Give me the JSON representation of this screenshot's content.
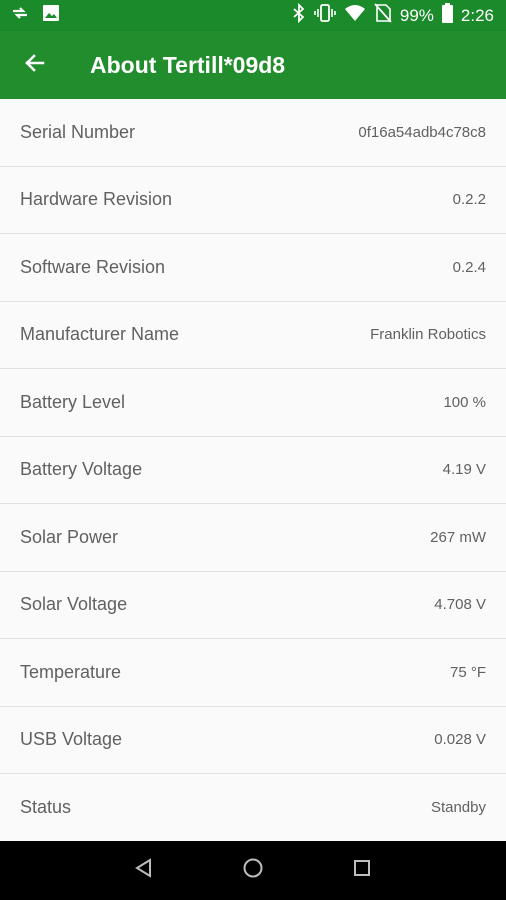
{
  "status_bar": {
    "battery_percent": "99%",
    "time": "2:26",
    "icons": [
      "sync-icon",
      "image-icon",
      "bluetooth-icon",
      "vibrate-icon",
      "wifi-icon",
      "no-sim-icon",
      "battery-icon"
    ]
  },
  "app_bar": {
    "title": "About Tertill*09d8"
  },
  "rows": [
    {
      "label": "Serial Number",
      "value": "0f16a54adb4c78c8"
    },
    {
      "label": "Hardware Revision",
      "value": "0.2.2"
    },
    {
      "label": "Software Revision",
      "value": "0.2.4"
    },
    {
      "label": "Manufacturer Name",
      "value": "Franklin Robotics"
    },
    {
      "label": "Battery Level",
      "value": "100 %"
    },
    {
      "label": "Battery Voltage",
      "value": "4.19 V"
    },
    {
      "label": "Solar Power",
      "value": "267 mW"
    },
    {
      "label": "Solar Voltage",
      "value": "4.708 V"
    },
    {
      "label": "Temperature",
      "value": "75 °F"
    },
    {
      "label": "USB Voltage",
      "value": "0.028 V"
    },
    {
      "label": "Status",
      "value": "Standby"
    }
  ],
  "colors": {
    "app_bar": "#218d2c",
    "status_bar": "#1a8a2a",
    "background": "#fafafa",
    "text": "#616161"
  }
}
